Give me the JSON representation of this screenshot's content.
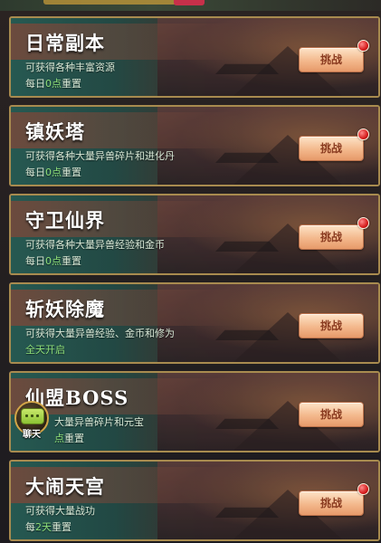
{
  "activities": [
    {
      "title": "日常副本",
      "description": "可获得各种丰富资源",
      "reset_prefix": "每日",
      "reset_highlight": "0点",
      "reset_suffix": "重置",
      "button_label": "挑战",
      "has_red_dot": true
    },
    {
      "title": "镇妖塔",
      "description": "可获得各种大量异兽碎片和进化丹",
      "reset_prefix": "每日",
      "reset_highlight": "0点",
      "reset_suffix": "重置",
      "button_label": "挑战",
      "has_red_dot": true
    },
    {
      "title": "守卫仙界",
      "description": "可获得各种大量异兽经验和金币",
      "reset_prefix": "每日",
      "reset_highlight": "0点",
      "reset_suffix": "重置",
      "button_label": "挑战",
      "has_red_dot": true
    },
    {
      "title": "斩妖除魔",
      "description": "可获得大量异兽经验、金币和修为",
      "reset_text": "全天开启",
      "button_label": "挑战",
      "has_red_dot": false
    },
    {
      "title": "仙盟BOSS",
      "description": "大量异兽碎片和元宝",
      "reset_highlight": "点",
      "reset_suffix": "重置",
      "button_label": "挑战",
      "has_red_dot": false
    },
    {
      "title": "大闹天宫",
      "description": "可获得大量战功",
      "reset_prefix": "每",
      "reset_highlight": "2天",
      "reset_suffix": "重置",
      "button_label": "挑战",
      "has_red_dot": true
    }
  ],
  "chat": {
    "label": "聊天",
    "icon": "chat-bubble-icon"
  },
  "colors": {
    "border": "#a88b4f",
    "highlight_green": "#8fe07a",
    "button_text": "#8a3b20",
    "red_dot": "#d61e1e"
  }
}
